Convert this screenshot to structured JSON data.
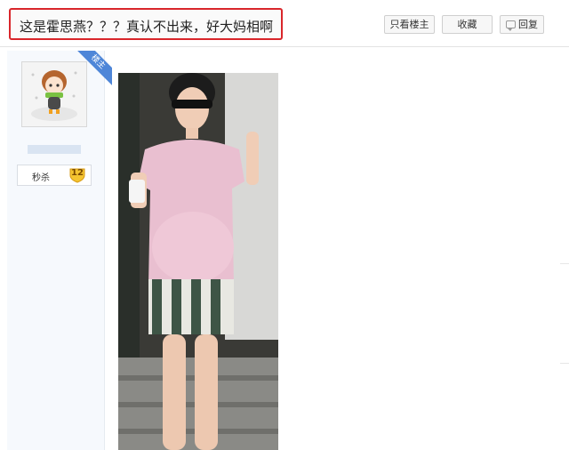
{
  "header": {
    "title": "这是霍思燕？？？真认不出来，好大妈相啊",
    "only_owner_label": "只看楼主",
    "favorite_label": "收藏",
    "reply_label": "回复"
  },
  "author": {
    "owner_tag": "楼主",
    "level_name": "秒杀",
    "level_number": "12"
  },
  "colors": {
    "highlight_border": "#d9262b",
    "owner_tag": "#4e86d8",
    "sidebar_bg": "#f6f9fd"
  },
  "icons": [
    "reply-icon",
    "level-badge-icon"
  ]
}
